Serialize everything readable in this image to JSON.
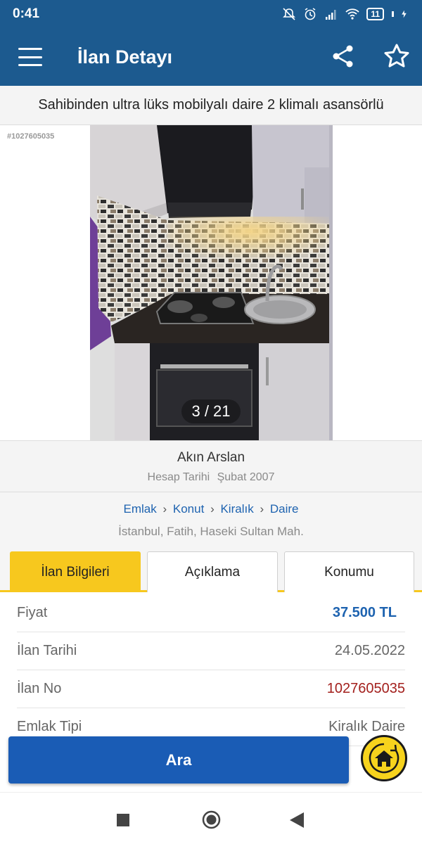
{
  "status_bar": {
    "time": "0:41",
    "battery": "11",
    "icons": [
      "notifications-off-icon",
      "alarm-icon",
      "signal-icon",
      "wifi-icon",
      "battery-icon",
      "charging-icon"
    ]
  },
  "app_bar": {
    "title": "İlan Detayı",
    "icons": [
      "menu-icon",
      "share-icon",
      "star-icon"
    ]
  },
  "listing": {
    "title": "Sahibinden ultra lüks mobilyalı daire 2 klimalı asansörlü",
    "photo_id": "#1027605035",
    "photo_counter": "3 / 21"
  },
  "seller": {
    "name": "Akın Arslan",
    "since_label": "Hesap Tarihi",
    "since_value": "Şubat 2007"
  },
  "breadcrumb": {
    "items": [
      "Emlak",
      "Konut",
      "Kiralık",
      "Daire"
    ],
    "separator": "›"
  },
  "location": "İstanbul, Fatih, Haseki Sultan Mah.",
  "tabs": [
    {
      "label": "İlan Bilgileri",
      "active": true
    },
    {
      "label": "Açıklama",
      "active": false
    },
    {
      "label": "Konumu",
      "active": false
    }
  ],
  "info": [
    {
      "key": "Fiyat",
      "value": "37.500 TL"
    },
    {
      "key": "İlan Tarihi",
      "value": "24.05.2022"
    },
    {
      "key": "İlan No",
      "value": "1027605035"
    },
    {
      "key": "Emlak Tipi",
      "value": "Kiralık Daire"
    }
  ],
  "actions": {
    "search_label": "Ara",
    "home_icon": "home-icon"
  },
  "colors": {
    "brand_blue": "#1c5a8f",
    "button_blue": "#1a5cb5",
    "accent_yellow": "#f7c81e",
    "price_blue": "#1e63b0",
    "id_red": "#a3201d"
  }
}
